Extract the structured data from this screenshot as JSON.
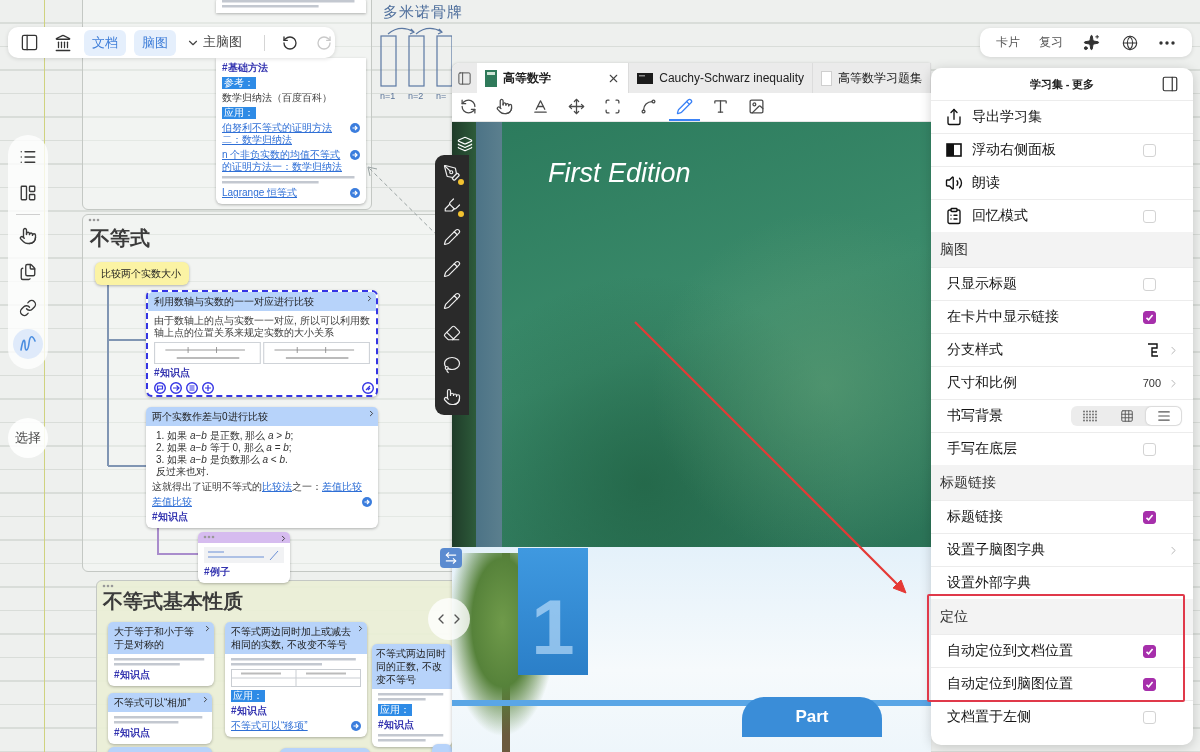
{
  "toolbar": {
    "tabs": [
      {
        "label": "文档",
        "selected": true
      },
      {
        "label": "脑图",
        "selected": true
      }
    ],
    "map_selector": "主脑图",
    "undo": {
      "disabled": false
    },
    "redo": {
      "disabled": true
    }
  },
  "side_tools": {
    "tools": [
      {
        "selected": false
      },
      {
        "selected": false
      },
      {
        "selected": false
      },
      {
        "selected": false
      },
      {
        "selected": false
      },
      {
        "selected": true
      }
    ],
    "select_button": "选择"
  },
  "canvas": {
    "sketch": {
      "title": "多米诺骨牌",
      "labels": [
        "n=1",
        "n=2",
        "n="
      ]
    },
    "note_card": {
      "blocks": [
        {
          "kind": "lines"
        },
        {
          "kind": "tag",
          "text": "#基础方法"
        },
        {
          "kind": "badge",
          "text": "参考："
        },
        {
          "kind": "text",
          "text": "数学归纳法（百度百科）"
        },
        {
          "kind": "badge",
          "text": "应用："
        },
        {
          "kind": "link",
          "text": "伯努利不等式的证明方法二：数学归纳法"
        },
        {
          "kind": "link",
          "text": "n 个非负实数的均值不等式的证明方法一：数学归纳法"
        },
        {
          "kind": "lines"
        },
        {
          "kind": "link",
          "text": "Lagrange 恒等式"
        }
      ]
    },
    "sections": [
      {
        "title": "不等式",
        "cards": [
          {
            "kind": "topic",
            "title": "比较两个实数大小",
            "selected": false,
            "collapsible": false
          },
          {
            "kind": "note",
            "title": "利用数轴与实数的一一对应进行比较",
            "selected": true,
            "collapsible": true,
            "blocks": [
              {
                "kind": "text",
                "text": "由于数轴上的点与实数一一对应, 所以可以利用数轴上点的位置关系来规定实数的大小关系"
              },
              {
                "kind": "numberline"
              },
              {
                "kind": "tag",
                "text": "#知识点"
              }
            ]
          },
          {
            "kind": "note",
            "title": "两个实数作差与0进行比较",
            "selected": false,
            "collapsible": true,
            "blocks": [
              {
                "kind": "list",
                "items": [
                  "1. 如果 *a*−*b* 是正数, 那么 *a* > *b*;",
                  "2. 如果 *a*−*b* 等于 0, 那么 *a* = *b*;",
                  "3. 如果 *a*−*b* 是负数那么 *a* < *b*.",
                  "反过来也对."
                ]
              },
              {
                "kind": "text",
                "parts": [
                  {
                    "text": "这就得出了证明不等式的"
                  },
                  {
                    "text": "比较法",
                    "link": true
                  },
                  {
                    "text": "之一："
                  },
                  {
                    "text": "差值比较",
                    "link": true
                  }
                ]
              },
              {
                "kind": "link",
                "text": "差值比较"
              },
              {
                "kind": "tag",
                "text": "#知识点"
              }
            ]
          },
          {
            "kind": "example",
            "selected": false,
            "collapsible": true,
            "blocks": [
              {
                "kind": "sketch"
              },
              {
                "kind": "tag",
                "text": "#例子"
              }
            ]
          }
        ]
      },
      {
        "title": "不等式基本性质",
        "cards": [
          {
            "kind": "note",
            "title": "大于等于和小于等于是对称的",
            "selected": false,
            "collapsible": true,
            "blocks": [
              {
                "kind": "lines"
              },
              {
                "kind": "tag",
                "text": "#知识点"
              }
            ]
          },
          {
            "kind": "note",
            "title": "不等式可以“相加”",
            "selected": false,
            "collapsible": true,
            "blocks": [
              {
                "kind": "lines"
              },
              {
                "kind": "tag",
                "text": "#知识点"
              }
            ]
          },
          {
            "kind": "stub",
            "selected": false,
            "collapsible": false
          },
          {
            "kind": "note",
            "title": "不等式两边同时加上或减去相同的实数, 不改变不等号",
            "selected": false,
            "collapsible": true,
            "blocks": [
              {
                "kind": "lines"
              },
              {
                "kind": "table"
              },
              {
                "kind": "badge",
                "text": "应用："
              },
              {
                "kind": "tag",
                "text": "#知识点"
              },
              {
                "kind": "link",
                "text": "不等式可以“移项”"
              }
            ]
          },
          {
            "kind": "stub",
            "selected": false,
            "collapsible": false
          },
          {
            "kind": "note",
            "title_parts": [
              "不等式两边同时",
              "同的正数, 不改变不等号"
            ],
            "selected": false,
            "collapsible": false,
            "blocks": [
              {
                "kind": "lines"
              },
              {
                "kind": "badge",
                "text": "应用："
              },
              {
                "kind": "tag",
                "text": "#知识点"
              },
              {
                "kind": "lines"
              }
            ]
          },
          {
            "kind": "stub",
            "selected": false,
            "collapsible": false
          }
        ]
      }
    ]
  },
  "document": {
    "tabs": [
      {
        "label": "高等数学",
        "selected": true
      },
      {
        "label": "Cauchy-Schwarz inequality",
        "selected": false
      },
      {
        "label": "高等数学习题集",
        "selected": false
      }
    ],
    "tools": [
      {
        "selected": false
      },
      {
        "selected": false
      },
      {
        "selected": false
      },
      {
        "selected": false
      },
      {
        "selected": false
      },
      {
        "selected": false
      },
      {
        "selected": true
      },
      {
        "selected": false
      },
      {
        "selected": false
      }
    ],
    "pen_tools": [
      {
        "kind": "pen",
        "color": "#f2c230"
      },
      {
        "kind": "pen",
        "color": "#f2c230"
      },
      {
        "kind": "tool"
      },
      {
        "kind": "tool"
      },
      {
        "kind": "tool"
      },
      {
        "kind": "tool"
      },
      {
        "kind": "tool"
      },
      {
        "kind": "tool"
      }
    ],
    "page": {
      "edition": "First Edition",
      "chapter": "1",
      "part": "Part"
    }
  },
  "top_actions": {
    "buttons": [
      "卡片",
      "复习"
    ]
  },
  "more_menu": {
    "title": "学习集 - 更多",
    "items": [
      {
        "kind": "action",
        "label": "导出学习集"
      },
      {
        "kind": "toggle",
        "label": "浮动右侧面板",
        "checked": false
      },
      {
        "kind": "action",
        "label": "朗读"
      },
      {
        "kind": "toggle",
        "label": "回忆模式",
        "checked": false
      },
      {
        "kind": "section",
        "label": "脑图"
      },
      {
        "kind": "toggle",
        "label": "只显示标题",
        "checked": false
      },
      {
        "kind": "toggle",
        "label": "在卡片中显示链接",
        "checked": true
      },
      {
        "kind": "submenu",
        "label": "分支样式"
      },
      {
        "kind": "submenu",
        "label": "尺寸和比例",
        "value": "700"
      },
      {
        "kind": "segmented",
        "label": "书写背景",
        "options": [
          {
            "selected": false
          },
          {
            "selected": false
          },
          {
            "selected": true
          }
        ]
      },
      {
        "kind": "toggle",
        "label": "手写在底层",
        "checked": false
      },
      {
        "kind": "section",
        "label": "标题链接"
      },
      {
        "kind": "toggle",
        "label": "标题链接",
        "checked": true
      },
      {
        "kind": "submenu",
        "label": "设置子脑图字典"
      },
      {
        "kind": "action",
        "label": "设置外部字典"
      },
      {
        "kind": "section",
        "label": "定位"
      },
      {
        "kind": "toggle",
        "label": "自动定位到文档位置",
        "checked": true
      },
      {
        "kind": "toggle",
        "label": "自动定位到脑图位置",
        "checked": true
      },
      {
        "kind": "toggle",
        "label": "文档置于左侧",
        "checked": false
      }
    ]
  }
}
